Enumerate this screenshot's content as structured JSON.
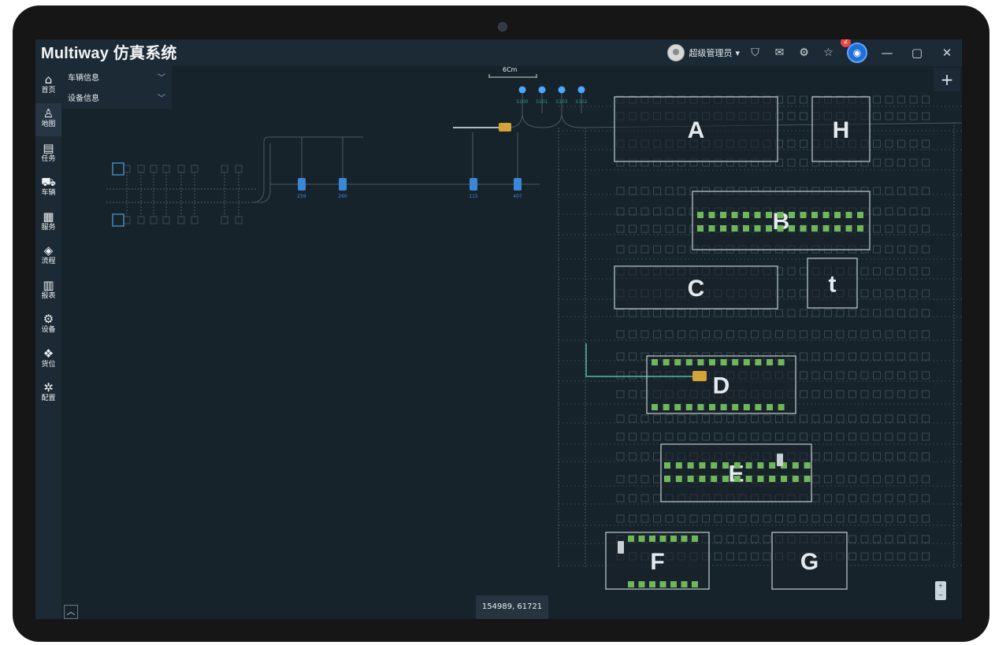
{
  "app": {
    "title": "Multiway 仿真系统"
  },
  "titlebar": {
    "user_name": "超级管理员",
    "user_caret": "▾",
    "notification_count": "2",
    "icons": [
      "shirt-icon",
      "mail-icon",
      "settings-icon",
      "star-icon",
      "bell-icon",
      "minimize-icon",
      "maximize-icon",
      "close-icon"
    ]
  },
  "sidebar": {
    "items": [
      {
        "label": "首页",
        "icon": "home-icon"
      },
      {
        "label": "地图",
        "icon": "map-icon",
        "active": true
      },
      {
        "label": "任务",
        "icon": "task-icon"
      },
      {
        "label": "车辆",
        "icon": "car-icon"
      },
      {
        "label": "服务",
        "icon": "service-icon"
      },
      {
        "label": "流程",
        "icon": "layers-icon"
      },
      {
        "label": "报表",
        "icon": "chart-icon"
      },
      {
        "label": "设备",
        "icon": "device-icon"
      },
      {
        "label": "货位",
        "icon": "cargo-icon"
      },
      {
        "label": "配置",
        "icon": "gear-icon"
      }
    ]
  },
  "info_panel": {
    "vehicle_info": "车辆信息",
    "device_info": "设备信息"
  },
  "map": {
    "scale_label": "6Cm",
    "coordinates": "154989, 61721",
    "zones": [
      "A",
      "H",
      "B",
      "C",
      "t",
      "D",
      "E",
      "F",
      "G"
    ],
    "pins": [
      "S100",
      "S101",
      "S103",
      "S102"
    ],
    "stations": [
      "259",
      "260",
      "115",
      "407"
    ]
  },
  "colors": {
    "background": "#17232a",
    "panel": "#1c2a35",
    "accent": "#1f6fd6",
    "slot_green": "#6fb85a",
    "station_blue": "#3b86d8"
  }
}
